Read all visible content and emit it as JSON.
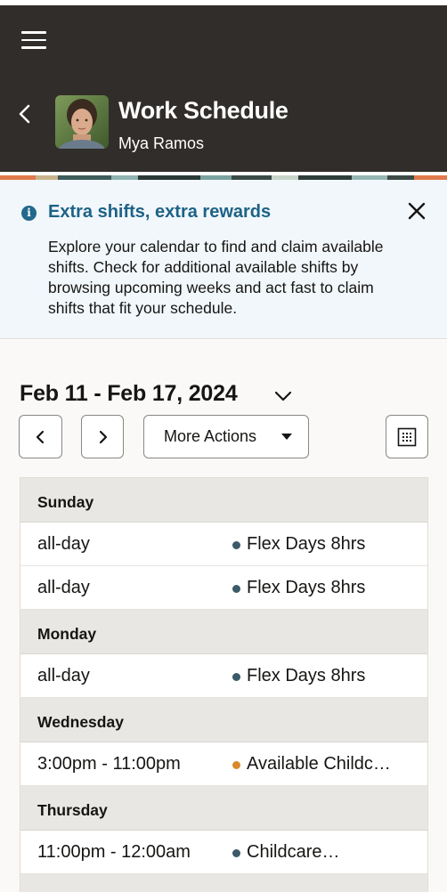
{
  "header": {
    "title": "Work Schedule",
    "subtitle": "Mya Ramos",
    "background": "#312d2a"
  },
  "notice": {
    "title": "Extra shifts, extra rewards",
    "body": "Explore your calendar to find and claim available shifts. Check for additional available shifts by browsing upcoming weeks and act fast to claim shifts that fit your schedule.",
    "accent": "#1d6286"
  },
  "toolbar": {
    "date_range": "Feb 11 - Feb 17, 2024",
    "more_actions_label": "More Actions"
  },
  "schedule": [
    {
      "day": "Sunday",
      "shifts": [
        {
          "time": "all-day",
          "name": "Flex Days 8hrs",
          "dot_color": "#3c5a69"
        },
        {
          "time": "all-day",
          "name": "Flex Days 8hrs",
          "dot_color": "#3c5a69"
        }
      ]
    },
    {
      "day": "Monday",
      "shifts": [
        {
          "time": "all-day",
          "name": "Flex Days 8hrs",
          "dot_color": "#3c5a69"
        }
      ]
    },
    {
      "day": "Wednesday",
      "shifts": [
        {
          "time": "3:00pm - 11:00pm",
          "name": "Available Childc…",
          "dot_color": "#d9892b"
        }
      ]
    },
    {
      "day": "Thursday",
      "shifts": [
        {
          "time": "11:00pm - 12:00am",
          "name": "Childcare…",
          "dot_color": "#3c5a69"
        }
      ]
    }
  ]
}
